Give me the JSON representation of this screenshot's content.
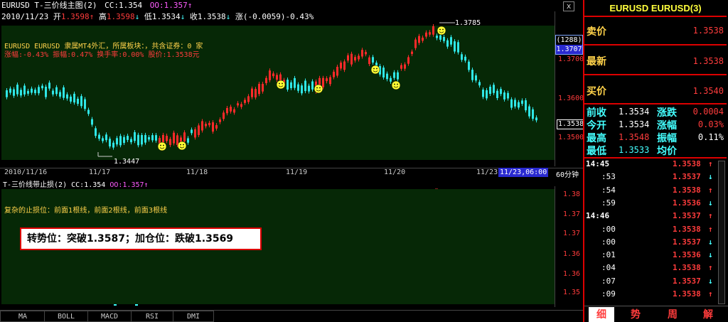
{
  "header": {
    "title_left": "EURUSD T-三价线主图(2)",
    "cc": "CC:1.354",
    "oo": "OO:1.357",
    "date": "2010/11/23",
    "open_label": "开",
    "open": "1.3598",
    "high_label": "高",
    "high": "1.3598",
    "low_label": "低",
    "low": "1.3534",
    "close_label": "收",
    "close": "1.3538",
    "change": "涨(-0.0059)-0.43%",
    "window_close": "x"
  },
  "main_chart": {
    "info_line1": "EURUSD EURUSD 隶属MT4外汇，所属板块：，共含证券：0 家",
    "info_line2": "涨幅:-0.43% 振幅:0.47% 换手率:0.00% 股价:1.3538元",
    "high_label": "1.3785",
    "low_label": "1.3447",
    "price_axis": [
      "1.3700",
      "1.3600",
      "1.3500"
    ],
    "badge_count": "(1288)",
    "badge_price": "1.3707",
    "current_price": "1.3538"
  },
  "time_axis": {
    "labels": [
      "2010/11/16",
      "11/17",
      "11/18",
      "11/19",
      "11/20",
      "11/23"
    ],
    "current": "11/23,06:00",
    "period": "60分钟"
  },
  "sub_chart": {
    "title": "T-三价线带止损(2)",
    "cc": "CC:1.354",
    "oo": "OO:1.357",
    "note": "复杂的止损位：前面1根线，前面2根线，前面3根线",
    "price_axis": [
      "1.38",
      "1.37",
      "1.36",
      "1.35"
    ],
    "extra_axis": [
      "1.37",
      "1.36"
    ],
    "callout": "转势位：突破1.3587；加仓位：跌破1.3569"
  },
  "bottom_tabs": [
    "MA",
    "BOLL",
    "MACD",
    "RSI",
    "DMI"
  ],
  "quote_panel": {
    "title": "EURUSD EURUSD(3)",
    "sell_label": "卖价",
    "sell": "1.3538",
    "last_label": "最新",
    "last": "1.3538",
    "buy_label": "买价",
    "buy": "1.3540",
    "stats": [
      {
        "l1": "前收",
        "v1": "1.3534",
        "l2": "涨跌",
        "v2": "0.0004"
      },
      {
        "l1": "今开",
        "v1": "1.3534",
        "l2": "涨幅",
        "v2": "0.03%"
      },
      {
        "l1": "最高",
        "v1": "1.3548",
        "l2": "振幅",
        "v2": "0.11%"
      },
      {
        "l1": "最低",
        "v1": "1.3533",
        "l2": "均价",
        "v2": ""
      }
    ],
    "ticks": [
      {
        "t": "14:45",
        "p": "1.3538",
        "dir": "up"
      },
      {
        "t": ":53",
        "p": "1.3537",
        "dir": "down"
      },
      {
        "t": ":54",
        "p": "1.3538",
        "dir": "up"
      },
      {
        "t": ":59",
        "p": "1.3536",
        "dir": "down"
      },
      {
        "t": "14:46",
        "p": "1.3537",
        "dir": "up"
      },
      {
        "t": ":00",
        "p": "1.3538",
        "dir": "up"
      },
      {
        "t": ":00",
        "p": "1.3537",
        "dir": "down"
      },
      {
        "t": ":01",
        "p": "1.3536",
        "dir": "down"
      },
      {
        "t": ":04",
        "p": "1.3538",
        "dir": "up"
      },
      {
        "t": ":07",
        "p": "1.3537",
        "dir": "down"
      },
      {
        "t": ":09",
        "p": "1.3538",
        "dir": "up"
      }
    ],
    "tabs": [
      "细",
      "势",
      "周",
      "解"
    ]
  }
}
